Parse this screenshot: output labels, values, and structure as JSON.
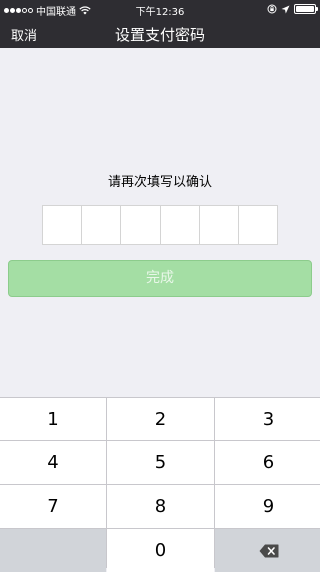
{
  "status_bar": {
    "carrier": "中国联通",
    "time": "下午12:36"
  },
  "nav": {
    "cancel_label": "取消",
    "title": "设置支付密码"
  },
  "prompt": "请再次填写以确认",
  "pin": {
    "length": 6,
    "entered": 0
  },
  "done_label": "完成",
  "keypad": {
    "keys": [
      "1",
      "2",
      "3",
      "4",
      "5",
      "6",
      "7",
      "8",
      "9",
      "0"
    ],
    "delete_icon": "backspace-icon"
  },
  "colors": {
    "nav_background": "#2e2d32",
    "page_background": "#efeff4",
    "done_button_disabled": "#a4dea4",
    "keypad_side_keys": "#d1d4d9"
  }
}
